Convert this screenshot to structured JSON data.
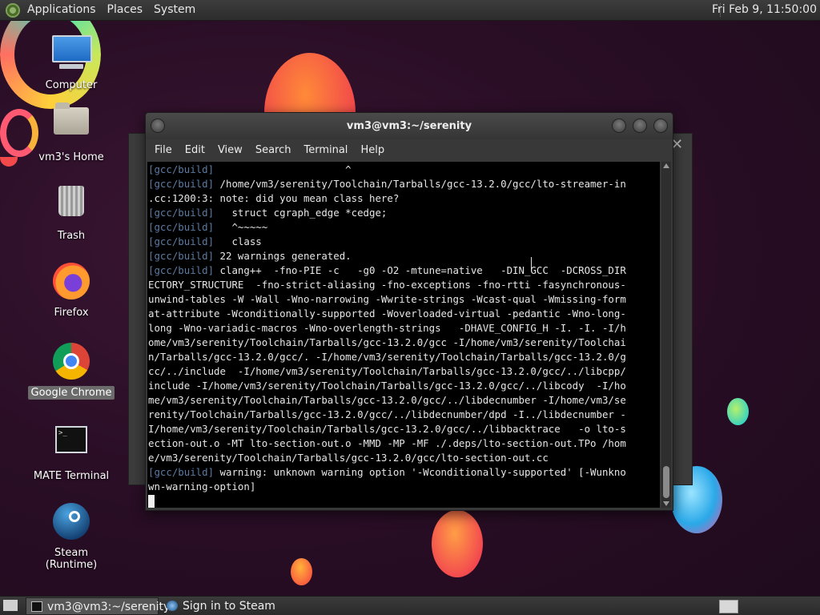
{
  "top_panel": {
    "menus": [
      "Applications",
      "Places",
      "System"
    ],
    "clock": "Fri Feb  9, 11:50:00"
  },
  "desktop_icons": [
    {
      "label": "Computer",
      "icon": "computer-icon"
    },
    {
      "label": "vm3's Home",
      "icon": "home-folder-icon"
    },
    {
      "label": "Trash",
      "icon": "trash-icon"
    },
    {
      "label": "Firefox",
      "icon": "firefox-icon"
    },
    {
      "label": "Google Chrome",
      "icon": "chrome-icon"
    },
    {
      "label": "MATE Terminal",
      "icon": "terminal-icon"
    },
    {
      "label": "Steam (Runtime)",
      "icon": "steam-icon"
    }
  ],
  "terminal": {
    "title": "vm3@vm3:~/serenity",
    "menu": [
      "File",
      "Edit",
      "View",
      "Search",
      "Terminal",
      "Help"
    ],
    "lines": [
      {
        "prefix": "[gcc/build]",
        "text": "                      ^"
      },
      {
        "prefix": "[gcc/build]",
        "text": " /home/vm3/serenity/Toolchain/Tarballs/gcc-13.2.0/gcc/lto-streamer-in"
      },
      {
        "prefix": "",
        "text": ".cc:1200:3: note: did you mean class here?"
      },
      {
        "prefix": "[gcc/build]",
        "text": "   struct cgraph_edge *cedge;"
      },
      {
        "prefix": "[gcc/build]",
        "text": "   ^~~~~~"
      },
      {
        "prefix": "[gcc/build]",
        "text": "   class"
      },
      {
        "prefix": "[gcc/build]",
        "text": " 22 warnings generated."
      },
      {
        "prefix": "[gcc/build]",
        "text": " clang++  -fno-PIE -c   -g0 -O2 -mtune=native   -DIN_GCC  -DCROSS_DIR"
      },
      {
        "prefix": "",
        "text": "ECTORY_STRUCTURE  -fno-strict-aliasing -fno-exceptions -fno-rtti -fasynchronous-"
      },
      {
        "prefix": "",
        "text": "unwind-tables -W -Wall -Wno-narrowing -Wwrite-strings -Wcast-qual -Wmissing-form"
      },
      {
        "prefix": "",
        "text": "at-attribute -Wconditionally-supported -Woverloaded-virtual -pedantic -Wno-long-"
      },
      {
        "prefix": "",
        "text": "long -Wno-variadic-macros -Wno-overlength-strings   -DHAVE_CONFIG_H -I. -I. -I/h"
      },
      {
        "prefix": "",
        "text": "ome/vm3/serenity/Toolchain/Tarballs/gcc-13.2.0/gcc -I/home/vm3/serenity/Toolchai"
      },
      {
        "prefix": "",
        "text": "n/Tarballs/gcc-13.2.0/gcc/. -I/home/vm3/serenity/Toolchain/Tarballs/gcc-13.2.0/g"
      },
      {
        "prefix": "",
        "text": "cc/../include  -I/home/vm3/serenity/Toolchain/Tarballs/gcc-13.2.0/gcc/../libcpp/"
      },
      {
        "prefix": "",
        "text": "include -I/home/vm3/serenity/Toolchain/Tarballs/gcc-13.2.0/gcc/../libcody  -I/ho"
      },
      {
        "prefix": "",
        "text": "me/vm3/serenity/Toolchain/Tarballs/gcc-13.2.0/gcc/../libdecnumber -I/home/vm3/se"
      },
      {
        "prefix": "",
        "text": "renity/Toolchain/Tarballs/gcc-13.2.0/gcc/../libdecnumber/dpd -I../libdecnumber -"
      },
      {
        "prefix": "",
        "text": "I/home/vm3/serenity/Toolchain/Tarballs/gcc-13.2.0/gcc/../libbacktrace   -o lto-s"
      },
      {
        "prefix": "",
        "text": "ection-out.o -MT lto-section-out.o -MMD -MP -MF ./.deps/lto-section-out.TPo /hom"
      },
      {
        "prefix": "",
        "text": "e/vm3/serenity/Toolchain/Tarballs/gcc-13.2.0/gcc/lto-section-out.cc"
      },
      {
        "prefix": "[gcc/build]",
        "text": " warning: unknown warning option '-Wconditionally-supported' [-Wunkno"
      },
      {
        "prefix": "",
        "text": "wn-warning-option]"
      }
    ]
  },
  "taskbar": {
    "tasks": [
      {
        "label": "vm3@vm3:~/serenity",
        "icon": "terminal-icon",
        "active": true
      },
      {
        "label": "Sign in to Steam",
        "icon": "steam-icon",
        "active": false
      }
    ]
  },
  "colors": {
    "prompt_prefix": "#5b7ba3",
    "terminal_bg": "#000000",
    "terminal_fg": "#e6e6e6"
  }
}
